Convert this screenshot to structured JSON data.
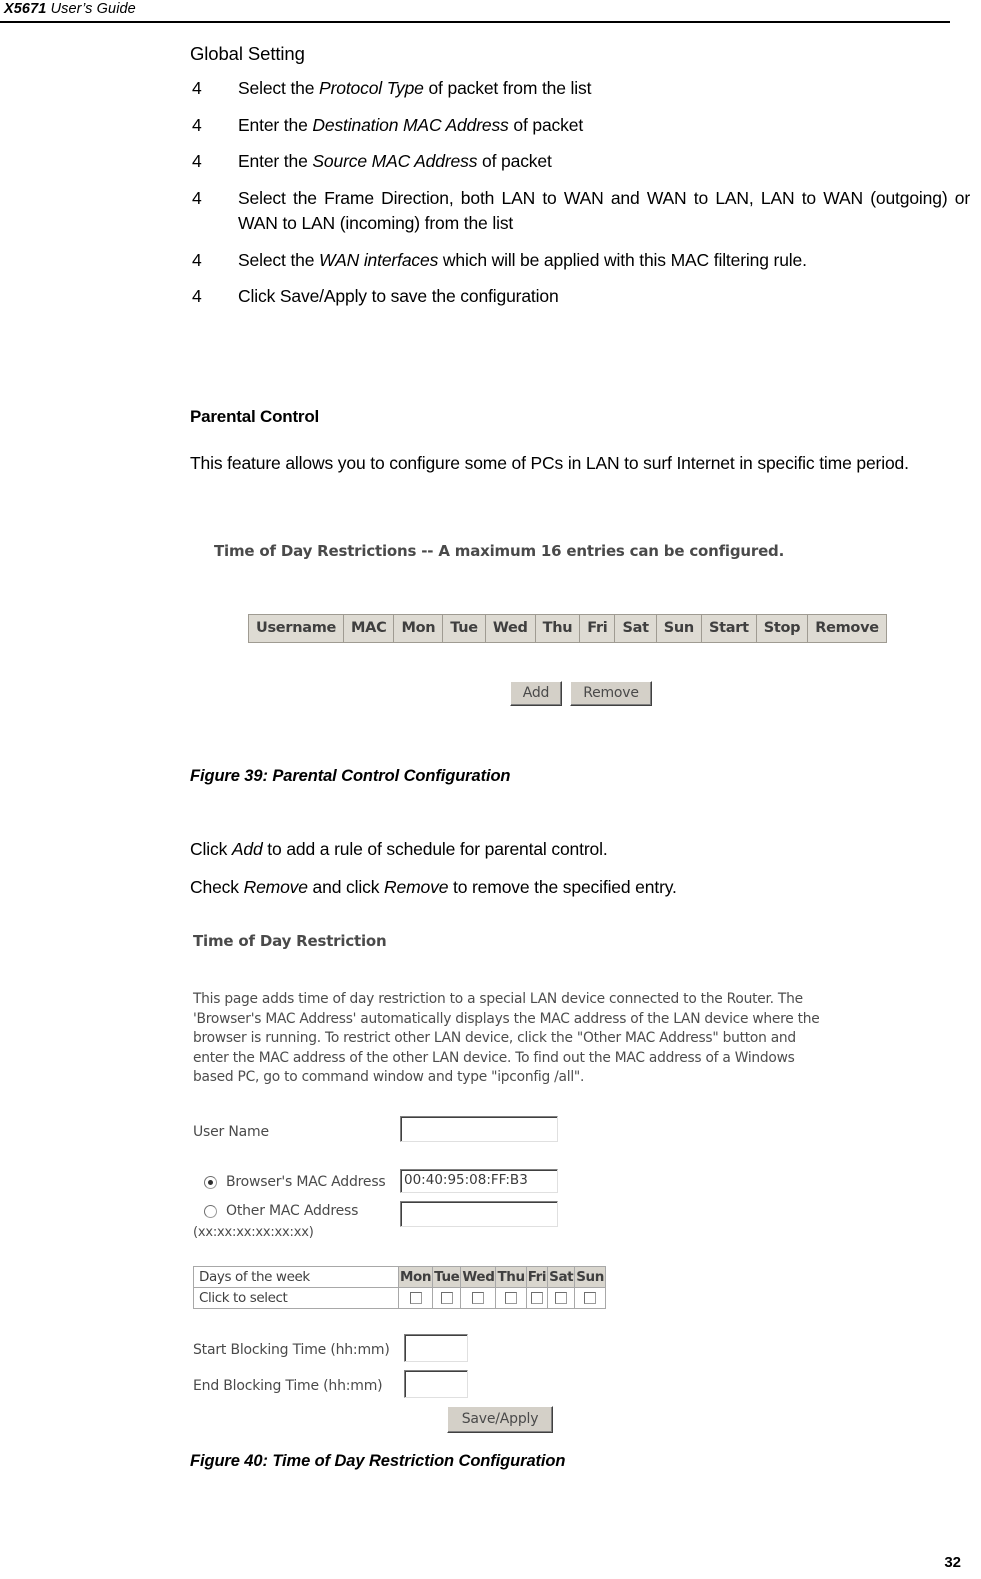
{
  "header": {
    "model": "X5671",
    "guide": " User’s Guide"
  },
  "section": {
    "global_setting_heading": "Global Setting",
    "bullet_marker": "4",
    "bullets": [
      {
        "pre": "Select the ",
        "em": "Protocol Type",
        "post": " of packet from the list"
      },
      {
        "pre": "Enter the ",
        "em": "Destination MAC Address",
        "post": " of packet"
      },
      {
        "pre": "Enter the ",
        "em": "Source MAC Address",
        "post": " of packet"
      },
      {
        "pre": "Select the Frame Direction, both LAN to WAN and WAN to LAN, LAN to WAN (outgoing) or WAN to LAN (incoming) from the list",
        "em": "",
        "post": ""
      },
      {
        "pre": "Select the ",
        "em": "WAN interfaces",
        "post": " which will be applied with this MAC filtering rule."
      },
      {
        "pre": "Click Save/Apply to save the configuration",
        "em": "",
        "post": ""
      }
    ]
  },
  "parental": {
    "heading": "Parental Control",
    "intro": "This feature allows you to configure some of PCs in LAN to surf Internet in specific time period.",
    "caption_39": "Figure 39: Parental Control Configuration",
    "click_add_pre": "Click ",
    "click_add_em": "Add",
    "click_add_post": " to add a rule of schedule for parental control.",
    "check_remove_pre": "Check ",
    "check_remove_em1": "Remove",
    "check_remove_mid": " and click ",
    "check_remove_em2": "Remove",
    "check_remove_post": " to remove the specified entry.",
    "caption_40": "Figure 40: Time of Day Restriction Configuration"
  },
  "figure39": {
    "title": "Time of Day Restrictions -- A maximum 16 entries can be configured.",
    "columns": [
      "Username",
      "MAC",
      "Mon",
      "Tue",
      "Wed",
      "Thu",
      "Fri",
      "Sat",
      "Sun",
      "Start",
      "Stop",
      "Remove"
    ],
    "add_button": "Add",
    "remove_button": "Remove"
  },
  "figure40": {
    "title": "Time of Day Restriction",
    "description": "This page adds time of day restriction to a special LAN device connected to the Router. The 'Browser's MAC Address' automatically displays the MAC address of the LAN device where the browser is running. To restrict other LAN device, click the \"Other MAC Address\" button and enter the MAC address of the other LAN device. To find out the MAC address of a Windows based PC, go to command window and type \"ipconfig /all\".",
    "user_name_label": "User Name",
    "user_name_value": "",
    "browser_mac_label": "Browser's MAC Address",
    "browser_mac_value": "00:40:95:08:FF:B3",
    "other_mac_label": "Other MAC Address",
    "other_mac_format": "(xx:xx:xx:xx:xx:xx)",
    "other_mac_value": "",
    "days_label": "Days of the week",
    "click_label": "Click to select",
    "days": [
      "Mon",
      "Tue",
      "Wed",
      "Thu",
      "Fri",
      "Sat",
      "Sun"
    ],
    "start_label": "Start Blocking Time (hh:mm)",
    "start_value": "",
    "end_label": "End Blocking Time (hh:mm)",
    "end_value": "",
    "save_button": "Save/Apply"
  },
  "footer": {
    "page_number": "32"
  }
}
